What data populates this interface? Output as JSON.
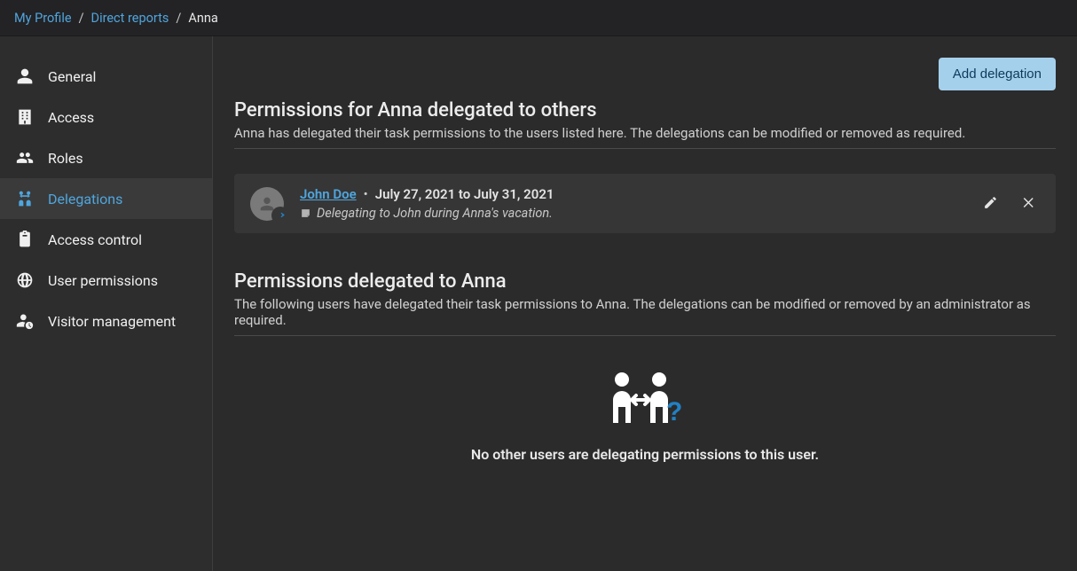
{
  "breadcrumb": {
    "items": [
      "My Profile",
      "Direct reports",
      "Anna"
    ]
  },
  "sidebar": {
    "items": [
      {
        "label": "General"
      },
      {
        "label": "Access"
      },
      {
        "label": "Roles"
      },
      {
        "label": "Delegations"
      },
      {
        "label": "Access control"
      },
      {
        "label": "User permissions"
      },
      {
        "label": "Visitor management"
      }
    ],
    "active_index": 3
  },
  "actions": {
    "add_delegation": "Add delegation"
  },
  "section1": {
    "title": "Permissions for Anna delegated to others",
    "desc": "Anna has delegated their task permissions to the users listed here. The delegations can be modified or removed as required.",
    "delegations": [
      {
        "name": "John Doe",
        "date_range": "July 27, 2021 to July 31, 2021",
        "note": "Delegating to John during Anna's vacation."
      }
    ]
  },
  "section2": {
    "title": "Permissions delegated to Anna",
    "desc": "The following users have delegated their task permissions to Anna. The delegations can be modified or removed by an administrator as required.",
    "empty_message": "No other users are delegating permissions to this user."
  }
}
